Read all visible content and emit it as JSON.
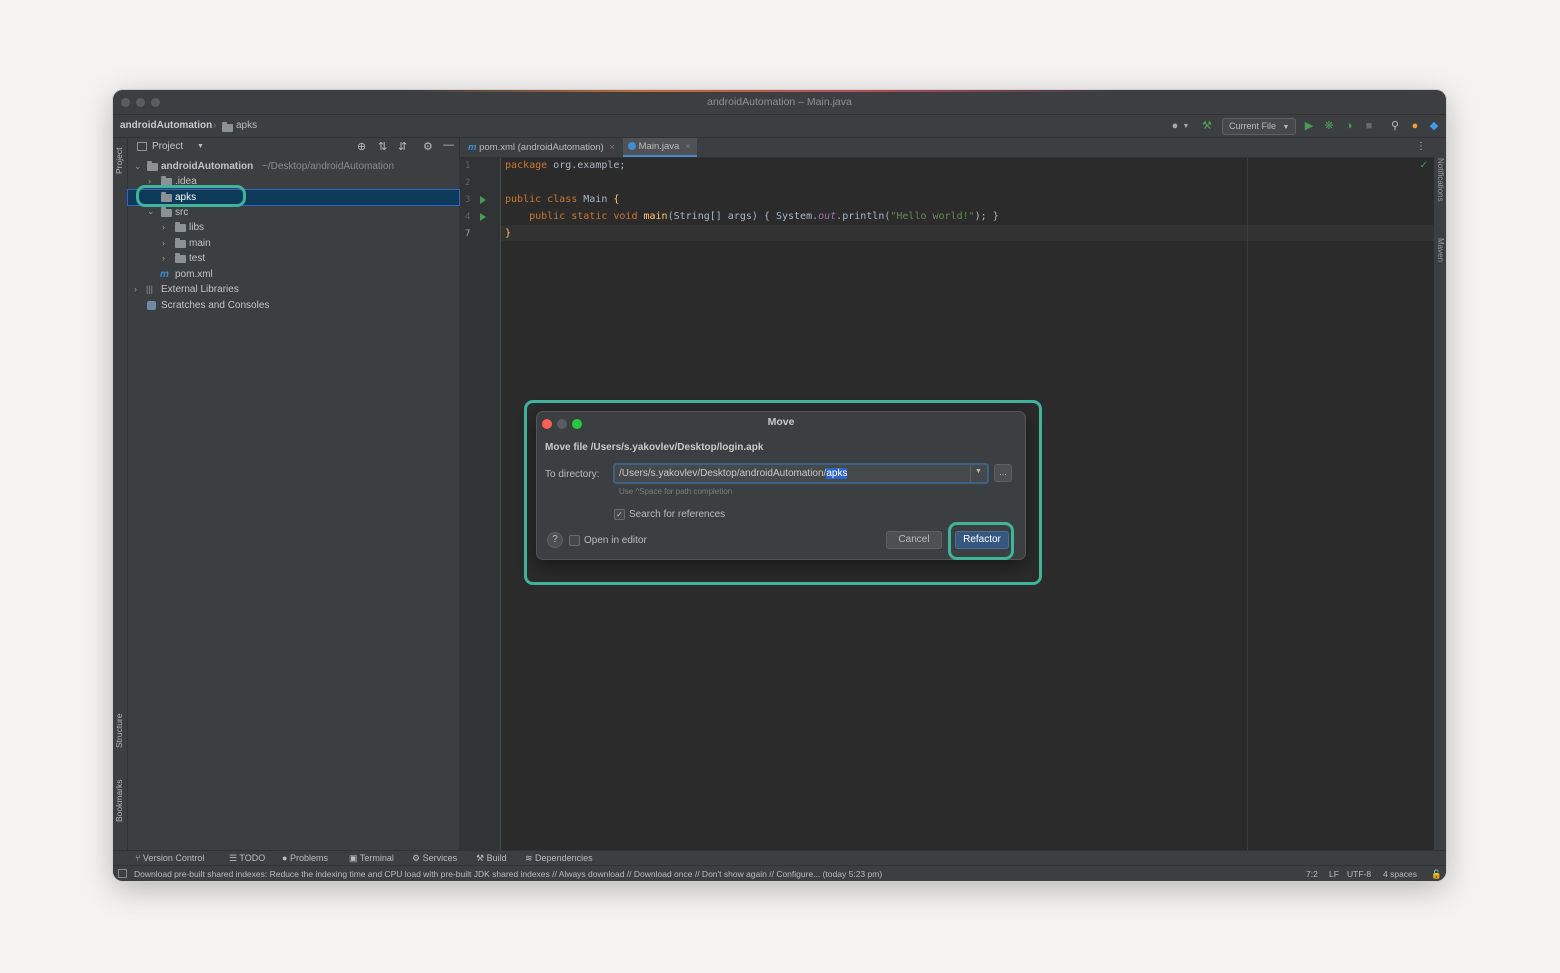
{
  "window": {
    "title": "androidAutomation – Main.java"
  },
  "breadcrumb": {
    "project": "androidAutomation",
    "folder": "apks"
  },
  "toolbar": {
    "run_config": "Current File",
    "icons": [
      "user-icon",
      "build-hammer-icon",
      "run-icon",
      "debug-icon",
      "coverage-icon",
      "stop-icon",
      "search-icon",
      "update-icon",
      "jetbrains-logo-icon"
    ]
  },
  "left_strip": {
    "project": "Project",
    "structure": "Structure",
    "bookmarks": "Bookmarks"
  },
  "right_strip": {
    "notifications": "Notifications",
    "maven": "Maven"
  },
  "project_panel": {
    "title": "Project",
    "tree": [
      {
        "label": "androidAutomation",
        "suffix": "~/Desktop/androidAutomation"
      },
      {
        "label": ".idea"
      },
      {
        "label": "apks"
      },
      {
        "label": "src"
      },
      {
        "label": "libs"
      },
      {
        "label": "main"
      },
      {
        "label": "test"
      },
      {
        "label": "pom.xml"
      },
      {
        "label": "External Libraries"
      },
      {
        "label": "Scratches and Consoles"
      }
    ]
  },
  "editor": {
    "tabs": [
      {
        "label": "pom.xml (androidAutomation)"
      },
      {
        "label": "Main.java"
      }
    ],
    "line_numbers": [
      "1",
      "2",
      "3",
      "4",
      "7"
    ],
    "code": {
      "l1_kw": "package",
      "l1_rest": " org.example;",
      "l3_kw": "public class",
      "l3_rest": " Main ",
      "l3_brace": "{",
      "l4_kw": "public static void",
      "l4_fn": "main",
      "l4_args": "(String[] args) ",
      "l4_body_a": "{ System.",
      "l4_out": "out",
      "l4_body_b": ".println(",
      "l4_str": "\"Hello world!\"",
      "l4_end": "); }",
      "l7": "}"
    }
  },
  "dialog": {
    "title": "Move",
    "heading": "Move file /Users/s.yakovlev/Desktop/login.apk",
    "to_directory_label": "To directory:",
    "path_prefix": "/Users/s.yakovlev/Desktop/androidAutomation/",
    "path_selected": "apks",
    "browse_label": "...",
    "hint": "Use ^Space for path completion",
    "search_references_label": "Search for references",
    "search_references_checked": true,
    "open_in_editor_label": "Open in editor",
    "open_in_editor_checked": false,
    "help_label": "?",
    "cancel_label": "Cancel",
    "refactor_label": "Refactor"
  },
  "tool_tabs": [
    {
      "label": "Version Control"
    },
    {
      "label": "TODO"
    },
    {
      "label": "Problems"
    },
    {
      "label": "Terminal"
    },
    {
      "label": "Services"
    },
    {
      "label": "Build"
    },
    {
      "label": "Dependencies"
    }
  ],
  "status_bar": {
    "message": "Download pre-built shared indexes: Reduce the indexing time and CPU load with pre-built JDK shared indexes // Always download // Download once // Don't show again // Configure... (today 5:23 pm)",
    "position": "7:2",
    "line_sep": "LF",
    "encoding": "UTF-8",
    "indent": "4 spaces"
  },
  "colors": {
    "highlight": "#3fb49a",
    "accent_blue": "#2f65ca",
    "keyword": "#cc7832",
    "string": "#6a8759"
  }
}
